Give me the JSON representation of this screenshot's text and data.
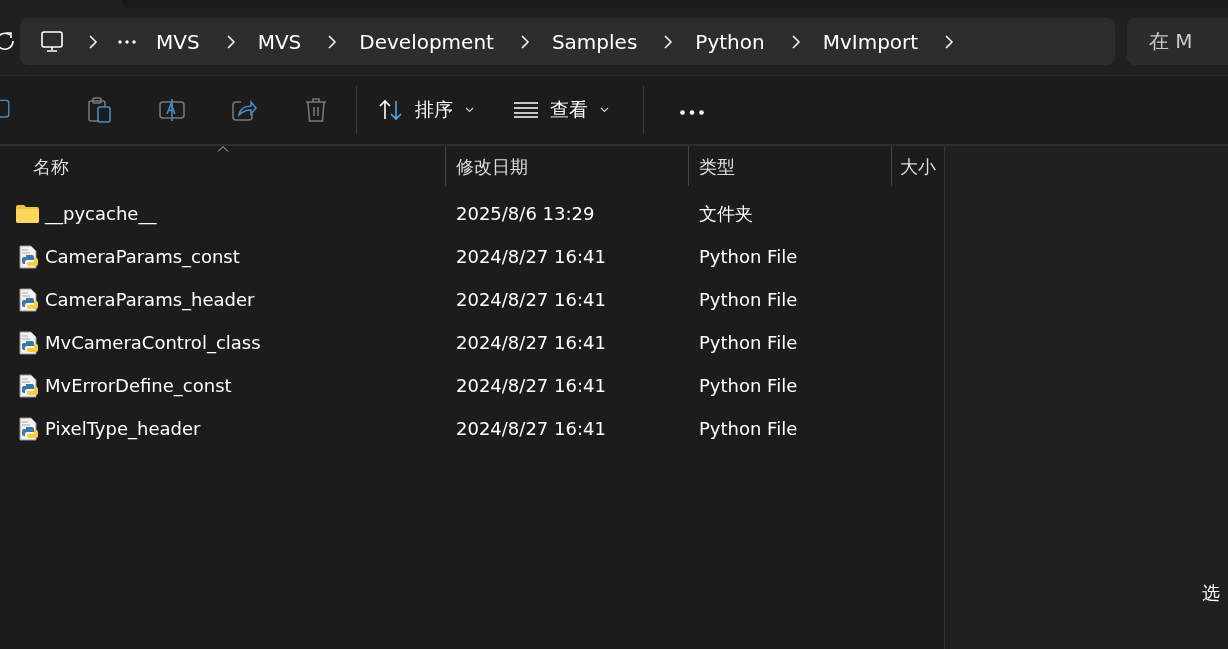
{
  "address_bar": {
    "path": [
      "MVS",
      "MVS",
      "Development",
      "Samples",
      "Python",
      "MvImport"
    ]
  },
  "search": {
    "placeholder": "在 M"
  },
  "toolbar": [
    {
      "kind": "icon",
      "disabled": true
    },
    {
      "kind": "icon",
      "disabled": true
    },
    {
      "kind": "icon",
      "disabled": true
    },
    {
      "kind": "icon",
      "disabled": true
    },
    {
      "kind": "icon",
      "disabled": true
    },
    {
      "kind": "separator"
    },
    {
      "kind": "menu",
      "label": "排序"
    },
    {
      "kind": "menu",
      "label": "查看"
    },
    {
      "kind": "separator"
    },
    {
      "kind": "more"
    }
  ],
  "columns": [
    {
      "label": "名称",
      "sorted": true
    },
    {
      "label": "修改日期",
      "sorted": false
    },
    {
      "label": "类型",
      "sorted": false
    },
    {
      "label": "大小",
      "sorted": false
    }
  ],
  "rows": [
    {
      "kind": "folder",
      "name": "__pycache__",
      "modified": "2025/8/6 13:29",
      "type": "文件夹"
    },
    {
      "kind": "python",
      "name": "CameraParams_const",
      "modified": "2024/8/27 16:41",
      "type": "Python File"
    },
    {
      "kind": "python",
      "name": "CameraParams_header",
      "modified": "2024/8/27 16:41",
      "type": "Python File"
    },
    {
      "kind": "python",
      "name": "MvCameraControl_class",
      "modified": "2024/8/27 16:41",
      "type": "Python File"
    },
    {
      "kind": "python",
      "name": "MvErrorDefine_const",
      "modified": "2024/8/27 16:41",
      "type": "Python File"
    },
    {
      "kind": "python",
      "name": "PixelType_header",
      "modified": "2024/8/27 16:41",
      "type": "Python File"
    }
  ],
  "details_pane": {
    "message": "选"
  }
}
